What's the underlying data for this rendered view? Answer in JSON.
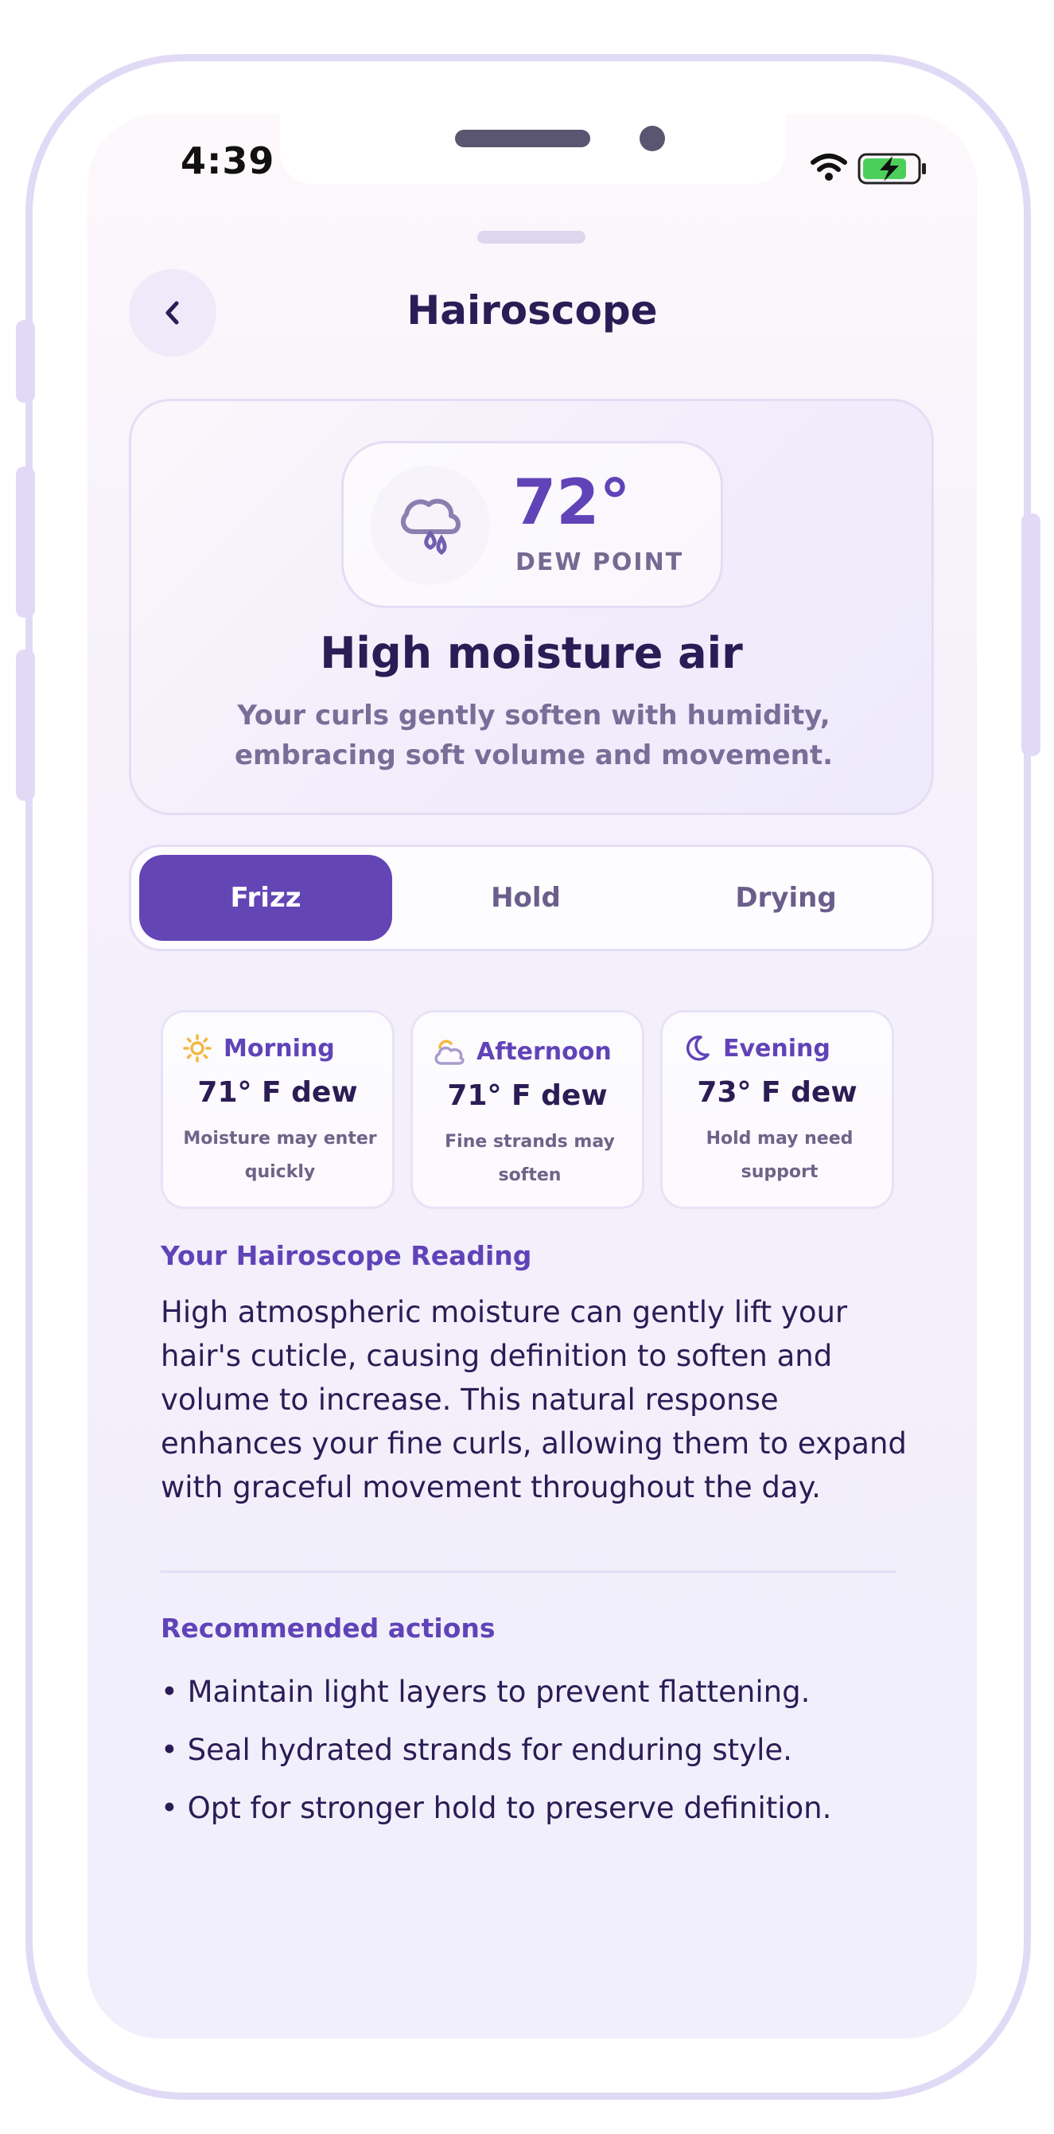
{
  "status_bar": {
    "time": "4:39"
  },
  "header": {
    "title": "Hairoscope"
  },
  "hero": {
    "temperature": "72°",
    "temperature_label": "DEW POINT",
    "headline": "High moisture air",
    "description": "Your curls gently soften with humidity, embracing soft volume and movement."
  },
  "tabs": [
    {
      "label": "Frizz",
      "active": true
    },
    {
      "label": "Hold",
      "active": false
    },
    {
      "label": "Drying",
      "active": false
    }
  ],
  "forecast": [
    {
      "period": "Morning",
      "icon": "sun-icon",
      "value": "71° F dew",
      "note": "Moisture may enter quickly"
    },
    {
      "period": "Afternoon",
      "icon": "partly-cloudy-icon",
      "value": "71° F dew",
      "note": "Fine strands may soften"
    },
    {
      "period": "Evening",
      "icon": "moon-icon",
      "value": "73° F dew",
      "note": "Hold may need support"
    }
  ],
  "reading": {
    "title": "Your Hairoscope Reading",
    "body": "High atmospheric moisture can gently lift your hair's cuticle, causing definition to soften and volume to increase. This natural response enhances your fine curls, allowing them to expand with graceful movement throughout the day."
  },
  "actions": {
    "title": "Recommended actions",
    "items": [
      "• Maintain light layers to prevent flattening.",
      "• Seal hydrated strands for enduring style.",
      "• Opt for stronger hold to preserve definition."
    ]
  },
  "colors": {
    "accent": "#6445b5",
    "text": "#2a1d55",
    "muted": "#7a6e98",
    "border": "#e4ddf4",
    "frame": "#e1daf6"
  }
}
